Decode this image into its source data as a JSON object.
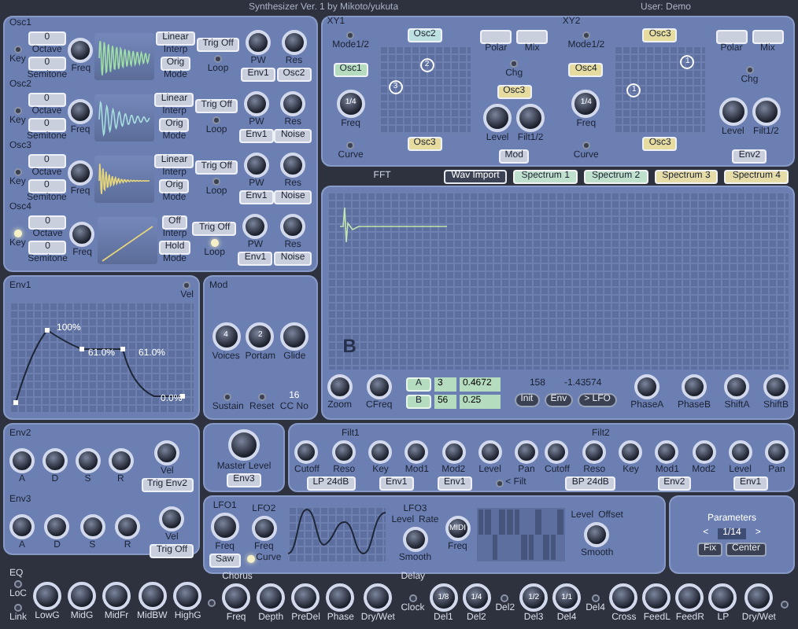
{
  "title": "Synthesizer Ver. 1 by Mikoto/yukuta",
  "user": "User: Demo",
  "oscillators": [
    {
      "name": "Osc1",
      "key_label": "Key",
      "key_on": false,
      "octave": "0",
      "octave_label": "Octave",
      "semitone": "0",
      "semitone_label": "Semitone",
      "freq_label": "Freq",
      "kind": "decay",
      "color": "#9fe0a4",
      "interp": "Linear",
      "interp_label": "Interp",
      "mode": "Orig",
      "mode_label": "Mode",
      "trig": "Trig Off",
      "loop_label": "Loop",
      "loop_on": false,
      "pw_label": "PW",
      "pw_source": "Env1",
      "res_label": "Res",
      "res_source": "Osc2"
    },
    {
      "name": "Osc2",
      "key_label": "Key",
      "key_on": false,
      "octave": "0",
      "octave_label": "Octave",
      "semitone": "0",
      "semitone_label": "Semitone",
      "freq_label": "Freq",
      "kind": "ring",
      "color": "#a8dede",
      "interp": "Linear",
      "interp_label": "Interp",
      "mode": "Orig",
      "mode_label": "Mode",
      "trig": "Trig Off",
      "loop_label": "Loop",
      "loop_on": false,
      "pw_label": "PW",
      "pw_source": "Env1",
      "res_label": "Res",
      "res_source": "Noise"
    },
    {
      "name": "Osc3",
      "key_label": "Key",
      "key_on": false,
      "octave": "0",
      "octave_label": "Octave",
      "semitone": "0",
      "semitone_label": "Semitone",
      "freq_label": "Freq",
      "kind": "burst",
      "color": "#e8d77a",
      "interp": "Linear",
      "interp_label": "Interp",
      "mode": "Orig",
      "mode_label": "Mode",
      "trig": "Trig Off",
      "loop_label": "Loop",
      "loop_on": false,
      "pw_label": "PW",
      "pw_source": "Env1",
      "res_label": "Res",
      "res_source": "Noise"
    },
    {
      "name": "Osc4",
      "key_label": "Key",
      "key_on": true,
      "octave": "0",
      "octave_label": "Octave",
      "semitone": "0",
      "semitone_label": "Semitone",
      "freq_label": "Freq",
      "kind": "ramp",
      "color": "#e8d77a",
      "interp": "Off",
      "interp_label": "Interp",
      "mode": "Hold",
      "mode_label": "Mode",
      "trig": "Trig Off",
      "loop_label": "Loop",
      "loop_on": true,
      "pw_label": "PW",
      "pw_source": "Env1",
      "res_label": "Res",
      "res_source": "Noise"
    }
  ],
  "xy": [
    {
      "name": "XY1",
      "mode_label": "Mode1/2",
      "left": {
        "label": "Osc1",
        "color": "#b5dcbf"
      },
      "freq_label": "Freq",
      "freq_value": "1/4",
      "curve_label": "Curve",
      "top": {
        "label": "Osc2",
        "color": "#bde0e0"
      },
      "bottom": {
        "label": "Osc3",
        "color": "#e6dca0"
      },
      "points": [
        "2",
        "3"
      ],
      "polar_label": "Polar",
      "mix_label": "Mix",
      "chg_label": "Chg",
      "side": {
        "label": "Osc3",
        "color": "#e6dca0"
      },
      "level_label": "Level",
      "filt_label": "Filt1/2",
      "source": "Mod"
    },
    {
      "name": "XY2",
      "mode_label": "Mode1/2",
      "left": {
        "label": "Osc4",
        "color": "#e6dca0"
      },
      "freq_label": "Freq",
      "freq_value": "1/4",
      "curve_label": "Curve",
      "top": {
        "label": "Osc3",
        "color": "#e6dca0"
      },
      "bottom": {
        "label": "Osc3",
        "color": "#e6dca0"
      },
      "points": [
        "1",
        "1"
      ],
      "polar_label": "Polar",
      "mix_label": "Mix",
      "chg_label": "Chg",
      "level_label": "Level",
      "filt_label": "Filt1/2",
      "source": "Env2"
    }
  ],
  "fft": {
    "label": "FFT",
    "tabs": [
      {
        "label": "Wav Import",
        "selected": true,
        "color": "#3b4254"
      },
      {
        "label": "Spectrum 1",
        "selected": false,
        "color": "#bfe0cc"
      },
      {
        "label": "Spectrum 2",
        "selected": false,
        "color": "#bfe0cc"
      },
      {
        "label": "Spectrum 3",
        "selected": false,
        "color": "#e6dca8"
      },
      {
        "label": "Spectrum 4",
        "selected": false,
        "color": "#e6dca8"
      }
    ],
    "marker": "B",
    "zoom_label": "Zoom",
    "cfreq_label": "CFreq",
    "rows": [
      {
        "button": "A",
        "index": "3",
        "value": "0.4672"
      },
      {
        "button": "B",
        "index": "56",
        "value": "0.25"
      }
    ],
    "readout_1": "158",
    "readout_2": "-1.43574",
    "buttons": [
      "Init",
      "Env",
      "> LFO"
    ],
    "knobs": [
      "PhaseA",
      "PhaseB",
      "ShiftA",
      "ShiftB"
    ]
  },
  "env1": {
    "name": "Env1",
    "vel_label": "Vel",
    "point_labels": [
      "100%",
      "61.0%",
      "61.0%",
      "0.0%"
    ]
  },
  "mod": {
    "name": "Mod",
    "voices_label": "Voices",
    "voices_value": "4",
    "portamento_label": "Portam",
    "portamento_value": "2",
    "glide_label": "Glide",
    "sustain_label": "Sustain",
    "reset_label": "Reset",
    "cc_value": "16",
    "cc_label": "CC No"
  },
  "envs": [
    {
      "name": "Env2",
      "knobs": [
        "A",
        "D",
        "S",
        "R"
      ],
      "vel_label": "Vel",
      "trig": "Trig Env2"
    },
    {
      "name": "Env3",
      "knobs": [
        "A",
        "D",
        "S",
        "R"
      ],
      "vel_label": "Vel",
      "trig": "Trig Off"
    }
  ],
  "master": {
    "label": "Master Level",
    "source": "Env3"
  },
  "filters": [
    {
      "name": "Filt1",
      "knobs": [
        "Cutoff",
        "Reso",
        "Key",
        "Mod1",
        "Mod2",
        "Level",
        "Pan"
      ],
      "type": "LP 24dB",
      "mod1": "Env1",
      "mod2": "Env1",
      "led_label": "< Filt"
    },
    {
      "name": "Filt2",
      "knobs": [
        "Cutoff",
        "Reso",
        "Key",
        "Mod1",
        "Mod2",
        "Level",
        "Pan"
      ],
      "type": "BP 24dB",
      "mod1": "Env2",
      "mod2": "Env1"
    }
  ],
  "lfo": {
    "lfo1": "LFO1",
    "lfo1_freq": "Freq",
    "lfo1_wave": "Saw",
    "lfo2": "LFO2",
    "lfo2_freq": "Freq",
    "curve_label": "Curve",
    "lfo3": "LFO3",
    "level_label": "Level",
    "rate_label": "Rate",
    "smooth_label": "Smooth",
    "freq_label": "Freq",
    "freq_value": "MIDI",
    "level2_label": "Level",
    "offset_label": "Offset",
    "smooth2_label": "Smooth"
  },
  "parameters": {
    "title": "Parameters",
    "prev": "<",
    "value": "1/14",
    "next": ">",
    "buttons": [
      "Fix",
      "Center"
    ]
  },
  "eq": {
    "title": "EQ",
    "leds": [
      "LoC",
      "Link"
    ],
    "knobs": [
      "LowG",
      "MidG",
      "MidFr",
      "MidBW",
      "HighG"
    ]
  },
  "chorus": {
    "title": "Chorus",
    "knobs": [
      "Freq",
      "Depth",
      "PreDel",
      "Phase",
      "Dry/Wet"
    ]
  },
  "delay": {
    "title": "Delay",
    "clock": "Clock",
    "delays": [
      {
        "label": "Del1",
        "value": "1/8"
      },
      {
        "label": "Del2",
        "value": "1/4",
        "led": "Del2"
      },
      {
        "label": "Del3",
        "value": "1/2"
      },
      {
        "label": "Del4",
        "value": "1/1",
        "led": "Del4"
      }
    ],
    "knobs": [
      "Cross",
      "FeedL",
      "FeedR",
      "LP",
      "Dry/Wet"
    ]
  }
}
